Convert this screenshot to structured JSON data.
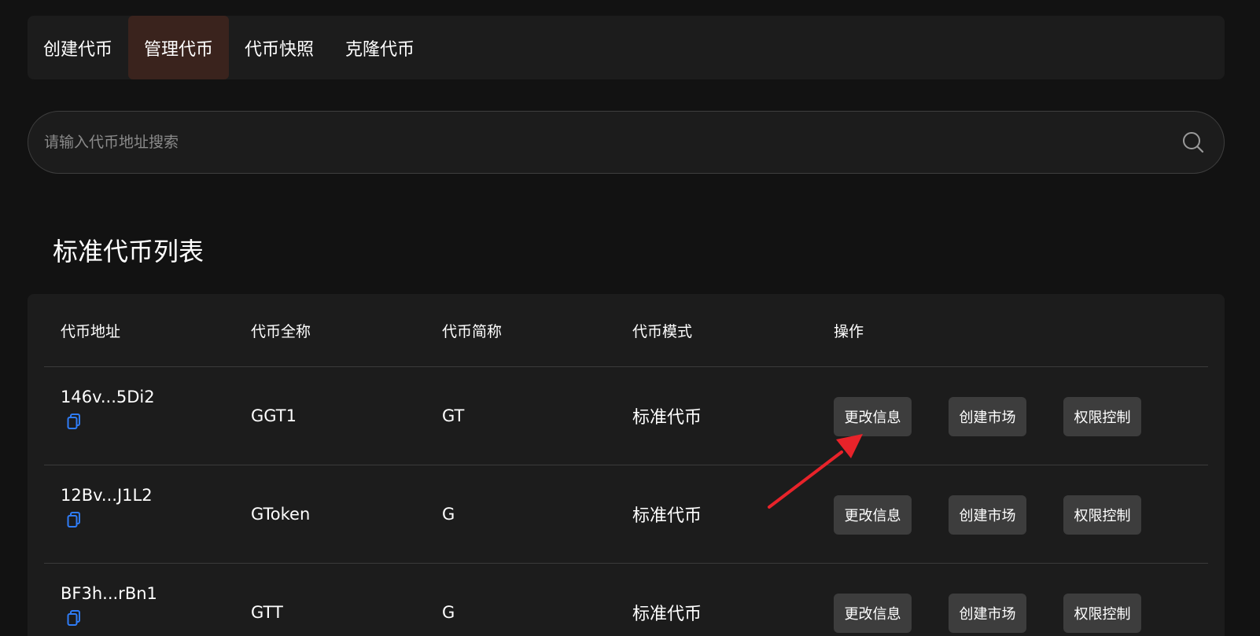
{
  "tabs": [
    {
      "label": "创建代币",
      "active": false
    },
    {
      "label": "管理代币",
      "active": true
    },
    {
      "label": "代币快照",
      "active": false
    },
    {
      "label": "克隆代币",
      "active": false
    }
  ],
  "search": {
    "placeholder": "请输入代币地址搜索",
    "icon": "search-icon"
  },
  "section": {
    "title": "标准代币列表"
  },
  "table": {
    "headers": {
      "address": "代币地址",
      "name": "代币全称",
      "symbol": "代币简称",
      "mode": "代币模式",
      "actions": "操作"
    },
    "rows": [
      {
        "address": "146v...5Di2",
        "name": "GGT1",
        "symbol": "GT",
        "mode": "标准代币"
      },
      {
        "address": "12Bv...J1L2",
        "name": "GToken",
        "symbol": "G",
        "mode": "标准代币"
      },
      {
        "address": "BF3h...rBn1",
        "name": "GTT",
        "symbol": "G",
        "mode": "标准代币"
      }
    ],
    "actions": {
      "edit": "更改信息",
      "market": "创建市场",
      "permission": "权限控制"
    }
  },
  "colors": {
    "background": "#121212",
    "panel": "#1c1c1c",
    "active_tab": "#3a231d",
    "button": "#3d3d3d",
    "copy_icon": "#2f7cf6",
    "annotation_arrow": "#e8232a"
  }
}
